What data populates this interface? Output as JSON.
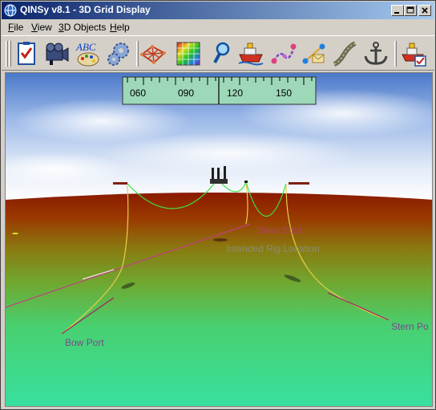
{
  "window": {
    "title": "QINSy v8.1 - 3D Grid Display",
    "app_icon": "qinsy-globe-icon",
    "controls": [
      "minimize-icon",
      "maximize-icon",
      "close-icon"
    ]
  },
  "menu": {
    "items": [
      {
        "label": "File",
        "accel": "F",
        "rest": "ile"
      },
      {
        "label": "View",
        "accel": "V",
        "rest": "iew"
      },
      {
        "label": "3D Objects",
        "accel": "3",
        "rest": "D Objects"
      },
      {
        "label": "Help",
        "accel": "H",
        "rest": "elp"
      }
    ]
  },
  "toolbar": {
    "abc_text": "ABC",
    "buttons": [
      "checklist-icon",
      "video-camera-icon",
      "abc-palette-icon",
      "gears-icon",
      "grid-net-icon",
      "color-grid-icon",
      "magnifier-icon",
      "vessel-icon",
      "route-icon",
      "waypoint-icon",
      "rope-icon",
      "anchor-icon",
      "vessel-settings-icon"
    ]
  },
  "compass": {
    "labels": [
      "060",
      "090",
      "120",
      "150"
    ]
  },
  "scene": {
    "labels": {
      "stern_stbd": "Stern Stbd",
      "intended_rig": "Intended Rig Location",
      "bow_port": "Bow Port",
      "stern_port": "Stern Po"
    },
    "colors": {
      "label_text": "#7a4a6a",
      "rig_label": "#6a6a6a",
      "line_yellow": "#e8d048",
      "line_green": "#40e040",
      "line_magenta": "#c04080",
      "sky_top": "#4a78c8",
      "seabed_far": "#8a1a00",
      "seabed_near": "#38e0a0"
    }
  }
}
